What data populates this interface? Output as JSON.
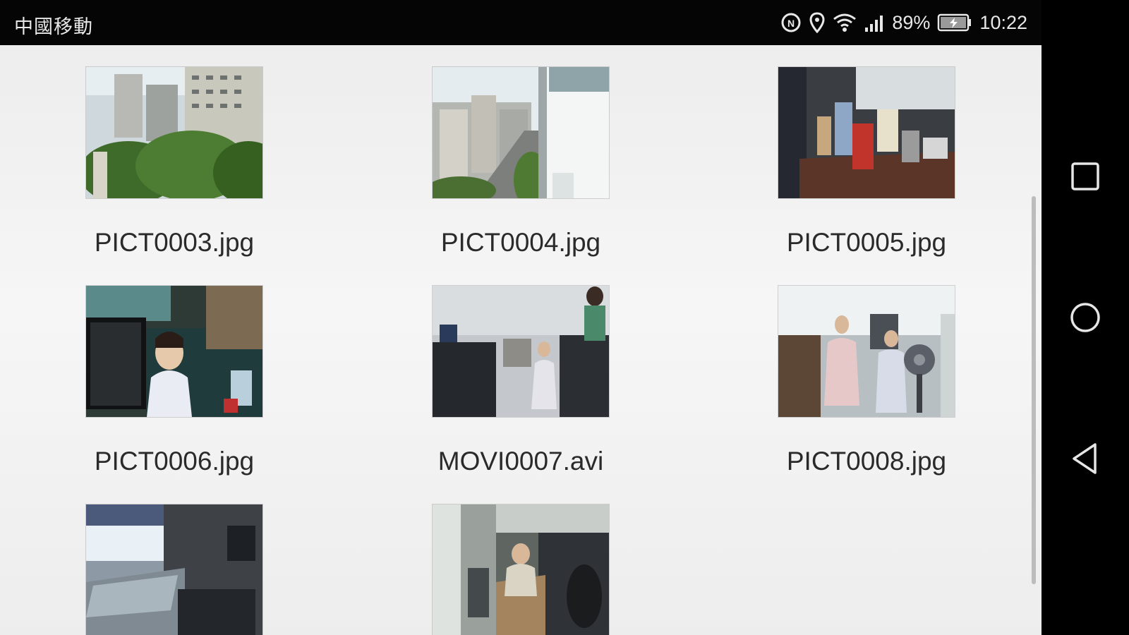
{
  "status_bar": {
    "carrier": "中國移動",
    "battery_percent": "89%",
    "time": "10:22",
    "icons": [
      "nfc-icon",
      "location-icon",
      "wifi-icon",
      "signal-icon",
      "battery-charging-icon"
    ]
  },
  "files": [
    {
      "name": "PICT0003.jpg",
      "scene": "city-trees"
    },
    {
      "name": "PICT0004.jpg",
      "scene": "street-view"
    },
    {
      "name": "PICT0005.jpg",
      "scene": "office-desk"
    },
    {
      "name": "PICT0006.jpg",
      "scene": "child-office"
    },
    {
      "name": "MOVI0007.avi",
      "scene": "office-wide"
    },
    {
      "name": "PICT0008.jpg",
      "scene": "children-fan"
    },
    {
      "name": "",
      "scene": "office-window"
    },
    {
      "name": "",
      "scene": "child-desk"
    }
  ],
  "nav": {
    "buttons": [
      "recent-apps",
      "home",
      "back"
    ]
  },
  "colors": {
    "status_bar_bg": "#050505",
    "content_bg": "#efefef",
    "label_text": "#2a2a2a",
    "nav_bg": "#000000"
  }
}
